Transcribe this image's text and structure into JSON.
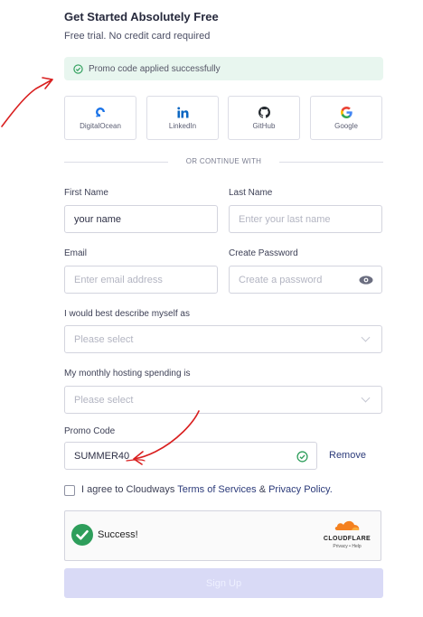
{
  "header": {
    "title": "Get Started Absolutely Free",
    "subtitle": "Free trial. No credit card required"
  },
  "promo_banner": {
    "text": "Promo code applied successfully",
    "color": "#e8f6ef"
  },
  "social": [
    {
      "label": "DigitalOcean",
      "icon": "digitalocean-icon"
    },
    {
      "label": "LinkedIn",
      "icon": "linkedin-icon"
    },
    {
      "label": "GitHub",
      "icon": "github-icon"
    },
    {
      "label": "Google",
      "icon": "google-icon"
    }
  ],
  "divider_text": "OR CONTINUE WITH",
  "form": {
    "first_name": {
      "label": "First Name",
      "value": "your name"
    },
    "last_name": {
      "label": "Last Name",
      "placeholder": "Enter your last name"
    },
    "email": {
      "label": "Email",
      "placeholder": "Enter email address"
    },
    "password": {
      "label": "Create Password",
      "placeholder": "Create a password"
    },
    "describe": {
      "label": "I would best describe myself as",
      "placeholder": "Please select"
    },
    "spending": {
      "label": "My monthly hosting spending is",
      "placeholder": "Please select"
    },
    "promo": {
      "label": "Promo Code",
      "value": "SUMMER40",
      "remove_label": "Remove"
    }
  },
  "agree": {
    "prefix": "I agree to Cloudways",
    "terms": "Terms of Services",
    "amp": "&",
    "privacy": "Privacy Policy."
  },
  "captcha": {
    "status": "Success!",
    "brand": "CLOUDFLARE",
    "privacy": "Privacy",
    "sep": "•",
    "help": "Help"
  },
  "signup_label": "Sign Up",
  "colors": {
    "accent": "#2c3b7a",
    "success": "#2e9e5b",
    "button_disabled": "#d9daf6",
    "annotation": "#d91f1f",
    "cloudflare": "#f48120"
  }
}
